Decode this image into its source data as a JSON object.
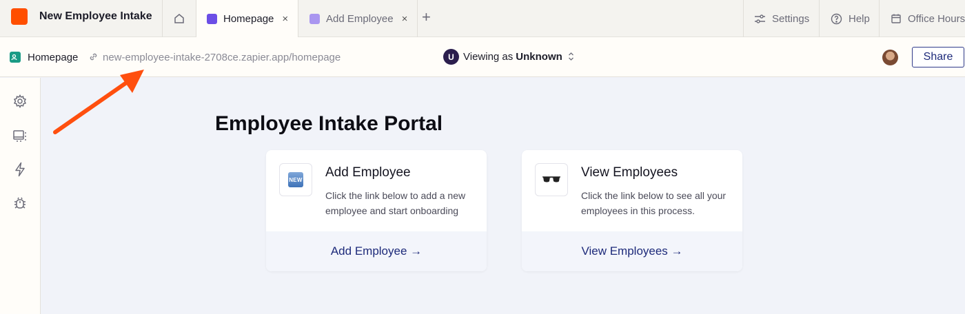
{
  "app": {
    "title": "New Employee Intake",
    "brand_color": "#ff4f00"
  },
  "tabs": [
    {
      "label": "Homepage",
      "active": true,
      "icon": "page-icon",
      "close": "×"
    },
    {
      "label": "Add Employee",
      "active": false,
      "icon": "page-icon",
      "close": "×"
    }
  ],
  "top_right": {
    "settings": "Settings",
    "help": "Help",
    "office_hours": "Office Hours"
  },
  "subbar": {
    "page_name": "Homepage",
    "url": "new-employee-intake-2708ce.zapier.app/homepage",
    "viewing_prefix": "Viewing as",
    "viewing_user": "Unknown",
    "user_badge": "U",
    "share": "Share"
  },
  "sidebar": {
    "items": [
      "gear-icon",
      "layout-icon",
      "lightning-icon",
      "bug-icon"
    ]
  },
  "main": {
    "title": "Employee Intake Portal",
    "cards": [
      {
        "emoji": "NEW",
        "title": "Add Employee",
        "description": "Click the link below to add a new employee and start onboarding",
        "link": "Add Employee →"
      },
      {
        "emoji": "sunglasses",
        "title": "View Employees",
        "description": "Click the link below to see all your employees in this process.",
        "link": "View Employees →"
      }
    ]
  },
  "colors": {
    "accent": "#1d2a7a",
    "annotation_arrow": "#ff4f0f"
  }
}
